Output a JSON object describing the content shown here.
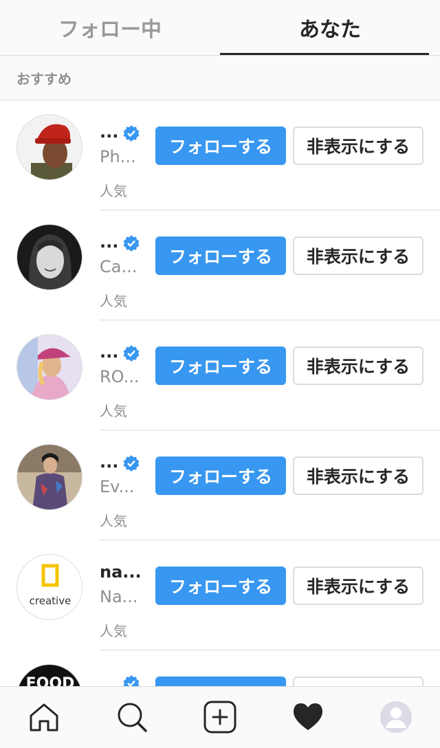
{
  "tabs": {
    "following": "フォロー中",
    "you": "あなた"
  },
  "section_title": "おすすめ",
  "suggestions": [
    {
      "username": "...",
      "verified": true,
      "fullname": "Ph...",
      "reason": "人気",
      "follow_label": "フォローする",
      "hide_label": "非表示にする"
    },
    {
      "username": "...",
      "verified": true,
      "fullname": "Ca...",
      "reason": "人気",
      "follow_label": "フォローする",
      "hide_label": "非表示にする"
    },
    {
      "username": "...",
      "verified": true,
      "fullname": "RO...",
      "reason": "人気",
      "follow_label": "フォローする",
      "hide_label": "非表示にする"
    },
    {
      "username": "...",
      "verified": true,
      "fullname": "Ev...",
      "reason": "人気",
      "follow_label": "フォローする",
      "hide_label": "非表示にする"
    },
    {
      "username": "na...",
      "verified": false,
      "fullname": "Na...",
      "reason": "人気",
      "follow_label": "フォローする",
      "hide_label": "非表示にする",
      "avatar_text": "creative"
    },
    {
      "username": "",
      "verified": true,
      "fullname": "",
      "reason": "",
      "follow_label": "",
      "hide_label": "",
      "avatar_text": "FOOD"
    }
  ],
  "bottom_nav": [
    "home-icon",
    "search-icon",
    "add-post-icon",
    "activity-heart-icon",
    "profile-icon"
  ],
  "colors": {
    "accent": "#3897f0",
    "text": "#262626",
    "secondary": "#8e8e8e",
    "border": "#dbdbdb"
  }
}
